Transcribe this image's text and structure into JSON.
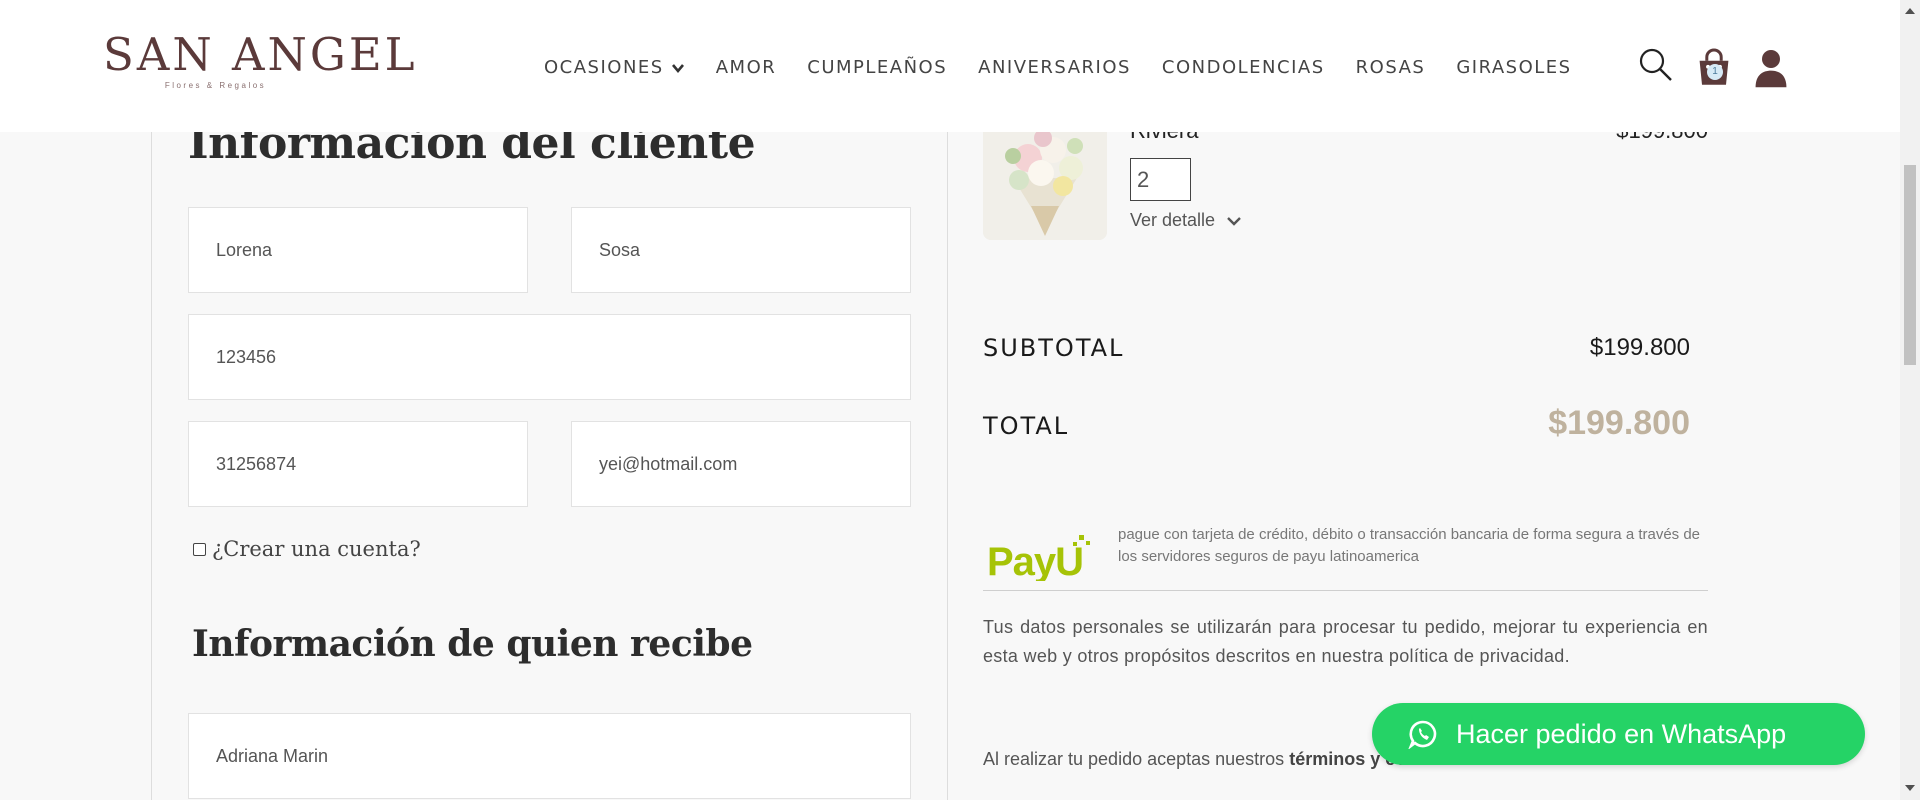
{
  "brand": {
    "name": "SAN ANGEL",
    "tagline": "Flores & Regalos"
  },
  "nav": {
    "items": [
      {
        "label": "OCASIONES"
      },
      {
        "label": "AMOR"
      },
      {
        "label": "CUMPLEAÑOS"
      },
      {
        "label": "ANIVERSARIOS"
      },
      {
        "label": "CONDOLENCIAS"
      },
      {
        "label": "ROSAS"
      },
      {
        "label": "GIRASOLES"
      }
    ],
    "cart_count": "1"
  },
  "client": {
    "heading": "Información del cliente",
    "first_name": "Lorena",
    "last_name": "Sosa",
    "id_number": "123456",
    "phone": "31256874",
    "email": "yei@hotmail.com",
    "create_account_label": "¿Crear una cuenta?"
  },
  "recipient": {
    "heading": "Información de quien recibe",
    "name": "Adriana Marin"
  },
  "order": {
    "product_name": "Riviera",
    "product_price": "$199.800",
    "quantity": "2",
    "details_label": "Ver detalle",
    "subtotal_label": "SUBTOTAL",
    "subtotal_value": "$199.800",
    "total_label": "TOTAL",
    "total_value": "$199.800",
    "payu_text": "pague con tarjeta de crédito, débito o transacción bancaria de forma segura a través de los servidores seguros de payu latinoamerica",
    "privacy_text": "Tus datos personales se utilizarán para procesar tu pedido, mejorar tu experiencia en esta web y otros propósitos descritos en nuestra política de privacidad.",
    "terms_prefix": "Al realizar tu pedido aceptas nuestros",
    "terms_link": "términos y condiciones"
  },
  "whatsapp": {
    "label": "Hacer pedido en WhatsApp"
  },
  "colors": {
    "brand": "#5b3a3a",
    "total_accent": "#bfb29e",
    "whatsapp": "#25d366",
    "payu_green": "#a6c307"
  }
}
